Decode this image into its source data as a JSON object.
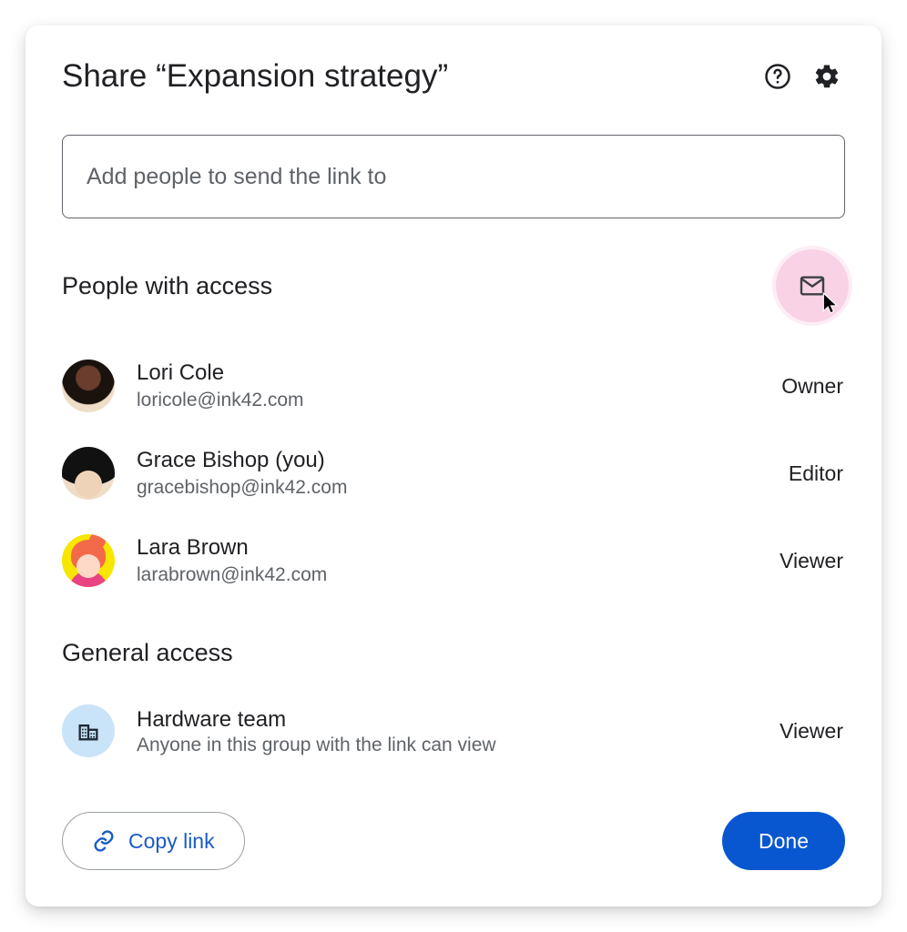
{
  "dialog": {
    "title": "Share “Expansion strategy”",
    "help_icon": "help",
    "settings_icon": "settings"
  },
  "input": {
    "placeholder": "Add people to send the link to"
  },
  "people_section": {
    "heading": "People with access",
    "email_button": "email-people"
  },
  "people": [
    {
      "name": "Lori Cole",
      "email": "loricole@ink42.com",
      "role": "Owner"
    },
    {
      "name": "Grace Bishop (you)",
      "email": "gracebishop@ink42.com",
      "role": "Editor"
    },
    {
      "name": "Lara Brown",
      "email": "larabrown@ink42.com",
      "role": "Viewer"
    }
  ],
  "general_section": {
    "heading": "General access"
  },
  "general": {
    "name": "Hardware team",
    "description": "Anyone in this group with the link can view",
    "role": "Viewer"
  },
  "footer": {
    "copy_link": "Copy link",
    "done": "Done"
  }
}
